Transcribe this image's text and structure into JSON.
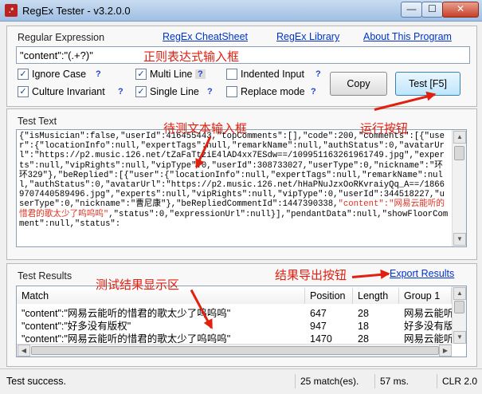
{
  "window": {
    "title": "RegEx Tester - v3.2.0.0",
    "app_icon": ".*",
    "min": "—",
    "max": "☐",
    "close": "✕"
  },
  "regex": {
    "label": "Regular Expression",
    "links": [
      "RegEx CheatSheet",
      "RegEx Library",
      "About This Program"
    ],
    "value": "\"content\":\"(.+?)\""
  },
  "options": {
    "ignore_case": "Ignore Case",
    "culture_invariant": "Culture Invariant",
    "multi_line": "Multi Line",
    "single_line": "Single Line",
    "indented_input": "Indented Input",
    "replace_mode": "Replace mode",
    "help": "?",
    "check": "✓"
  },
  "buttons": {
    "copy": "Copy",
    "test": "Test [F5]"
  },
  "test_text": {
    "label": "Test Text",
    "line1": "{\"isMusician\":false,\"userId\":416455443,\"topComments\":[],\"code\":200,\"comments\":[{\"user\":{\"locationInfo\":null,\"expertTags\":null,\"remarkName\":null,\"authStatus\":0,\"avatarUrl\":\"https://p2.music.126.net/tZaFaTtziE4lAD4xx7ESdw==/109951163261961749.jpg\",\"experts\":null,\"vipRights\":null,\"vipType\":0,\"userId\":308733027,\"userType\":0,\"nickname\":\"环环329\"},\"beReplied\":",
    "line2": "[{\"user\":{\"locationInfo\":null,\"expertTags\":null,\"remarkName\":null,\"authStatus\":0,\"avatarUrl\":\"https://p2.music.126.net/hHaPNuJzxOoRKvraiyQq_A==/18669707440589496.jpg\",\"experts\":null,\"vipRights\":null,\"vipType\":0,\"userId\":344518227,\"userType\":0,\"nickname\":\"曹尼",
    "line3": "康\"},\"beRepliedCommentId\":1447390338,",
    "highlight": "\"content\":\"网易云能听的惜君的歌太少了呜呜呜\"",
    "line4": ",\"status\":0,\"expressionUrl\":null}],\"pendantData\":null,\"showFloorComment\":null,\"status\":"
  },
  "results": {
    "label": "Test Results",
    "export": "Export Results",
    "columns": [
      "Match",
      "Position",
      "Length",
      "Group 1"
    ],
    "rows": [
      [
        "\"content\":\"网易云能听的惜君的歌太少了呜呜呜\"",
        "647",
        "28",
        "网易云能听的..."
      ],
      [
        "\"content\":\"好多没有版权\"",
        "947",
        "18",
        "好多没有版权"
      ],
      [
        "\"content\":\"网易云能听的惜君的歌太少了呜呜呜\"",
        "1470",
        "28",
        "网易云能听的..."
      ]
    ]
  },
  "status": {
    "message": "Test success.",
    "matches": "25 match(es).",
    "time": "57 ms.",
    "clr": "CLR 2.0"
  },
  "annotations": {
    "regex_input": "正则表达式输入框",
    "text_input": "待测文本输入框",
    "run_button": "运行按钮",
    "export_button": "结果导出按钮",
    "results_area": "测试结果显示区"
  }
}
